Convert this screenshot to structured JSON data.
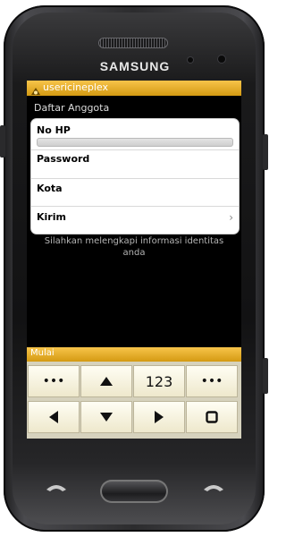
{
  "device": {
    "brand": "SAMSUNG"
  },
  "titlebar": {
    "app_title": "usericineplex"
  },
  "page": {
    "title": "Daftar Anggota"
  },
  "form": {
    "fields": [
      {
        "label": "No HP"
      },
      {
        "label": "Password"
      },
      {
        "label": "Kota"
      },
      {
        "label": "Kirim"
      }
    ],
    "chevron": "›"
  },
  "info_text": "Silahkan melengkapi informasi identitas anda",
  "menubar": {
    "label": "Mulai"
  },
  "keypad": {
    "row1": [
      {
        "label": "•••"
      },
      {
        "icon": "arrow-up-icon"
      },
      {
        "label": "123"
      },
      {
        "label": "•••"
      }
    ],
    "row2": [
      {
        "icon": "arrow-left-icon"
      },
      {
        "icon": "arrow-down-icon"
      },
      {
        "icon": "arrow-right-icon"
      },
      {
        "icon": "square-icon"
      }
    ]
  },
  "colors": {
    "accent": "#e0a520",
    "screen_bg": "#000000",
    "keypad_bg": "#f6f1da"
  }
}
